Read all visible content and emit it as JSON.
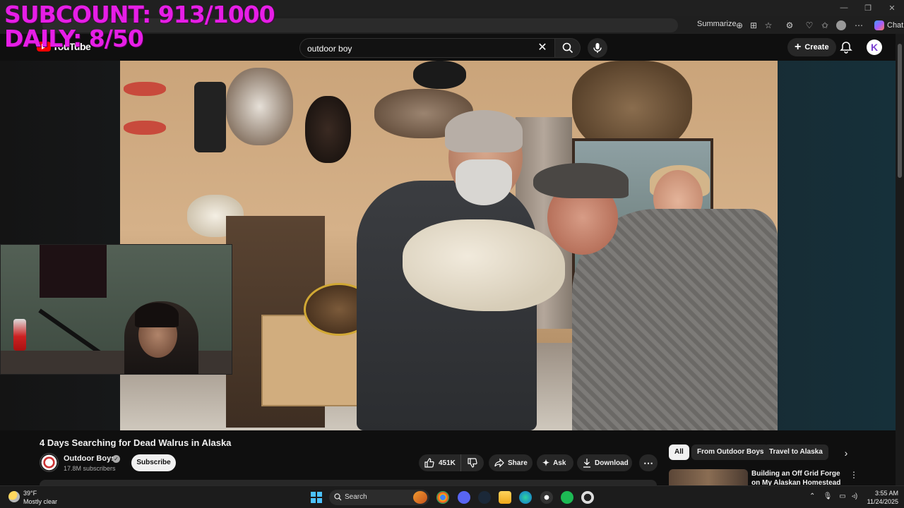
{
  "overlay": {
    "subcount": "SUBCOUNT: 913/1000",
    "daily": "DAILY: 8/50"
  },
  "browser": {
    "summarize_label": "Summarize",
    "chat_label": "Chat",
    "window_controls": [
      "—",
      "❐",
      "✕"
    ]
  },
  "youtube": {
    "logo_text": "YouTube",
    "search": {
      "value": "outdoor boy"
    },
    "create_label": "Create",
    "avatar_letter": "K"
  },
  "video": {
    "title": "4 Days Searching for Dead Walrus in Alaska",
    "channel": {
      "name": "Outdoor Boys",
      "subscribers": "17.8M subscribers"
    },
    "subscribe_label": "Subscribe",
    "likes": "451K",
    "share_label": "Share",
    "ask_label": "Ask",
    "download_label": "Download"
  },
  "sidebar": {
    "chips": [
      "All",
      "From Outdoor Boys",
      "Travel to Alaska"
    ],
    "recommendation": {
      "title": "Building an Off Grid Forge on My Alaskan Homestead"
    }
  },
  "taskbar": {
    "weather": {
      "temp": "39°F",
      "desc": "Mostly clear"
    },
    "search_label": "Search",
    "time": "3:55 AM",
    "date": "11/24/2025"
  },
  "colors": {
    "overlay_text": "#e61ee6",
    "youtube_red": "#ff0000",
    "background": "#0f0f0f"
  }
}
